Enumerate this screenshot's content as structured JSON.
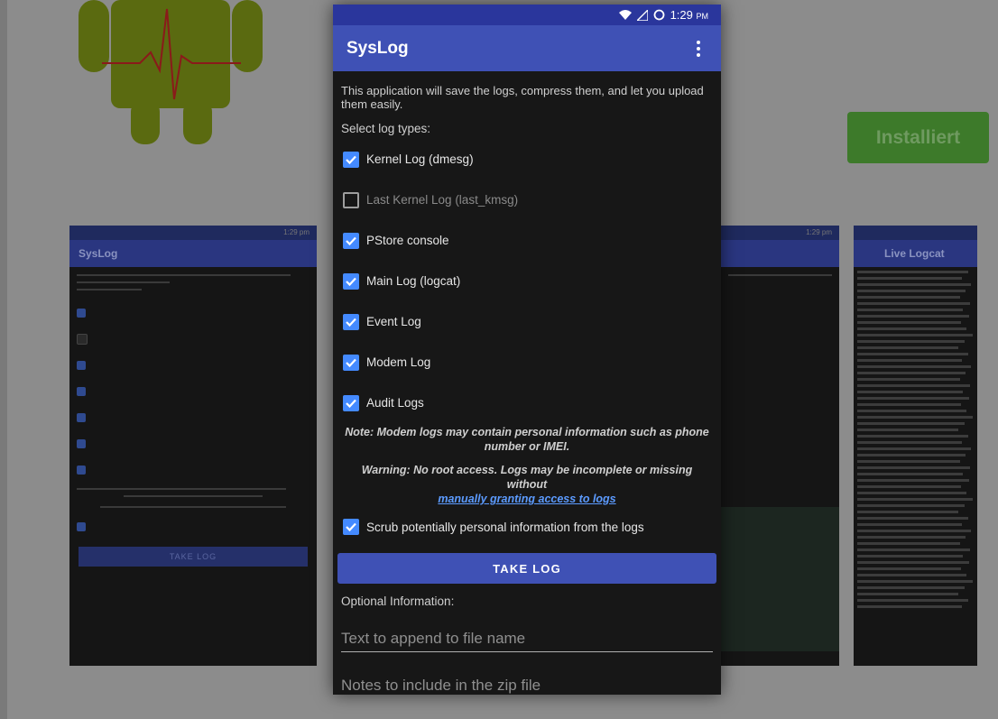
{
  "store": {
    "install_button": "Installiert"
  },
  "phone": {
    "status_time": "1:29",
    "status_ampm": "PM",
    "app_title": "SysLog",
    "intro": "This application will save the logs, compress them, and let you upload them easily.",
    "select_label": "Select log types:",
    "log_types": [
      {
        "label": "Kernel Log (dmesg)",
        "checked": true,
        "enabled": true
      },
      {
        "label": "Last Kernel Log (last_kmsg)",
        "checked": false,
        "enabled": false
      },
      {
        "label": "PStore console",
        "checked": true,
        "enabled": true
      },
      {
        "label": "Main Log (logcat)",
        "checked": true,
        "enabled": true
      },
      {
        "label": "Event Log",
        "checked": true,
        "enabled": true
      },
      {
        "label": "Modem Log",
        "checked": true,
        "enabled": true
      },
      {
        "label": "Audit Logs",
        "checked": true,
        "enabled": true
      }
    ],
    "note": "Note: Modem logs may contain personal information such as phone number or IMEI.",
    "warning": "Warning: No root access. Logs may be incomplete or missing without",
    "warning_link": "manually granting access to logs",
    "scrub_label": "Scrub potentially personal information from the logs",
    "take_log_button": "TAKE LOG",
    "optional_label": "Optional Information:",
    "filename_placeholder": "Text to append to file name",
    "notes_placeholder": "Notes to include in the zip file"
  },
  "mini_shot_left": {
    "status_time": "1:29 pm",
    "app_title": "SysLog",
    "take_log_button": "TAKE LOG"
  },
  "mini_shot_mid": {
    "status_time": "1:29 pm"
  },
  "mini_shot_right": {
    "app_title": "Live Logcat"
  },
  "colors": {
    "primary": "#3f51b5",
    "status_bar": "#2a369c",
    "checkbox_accent": "#448aff",
    "background": "#171717"
  }
}
